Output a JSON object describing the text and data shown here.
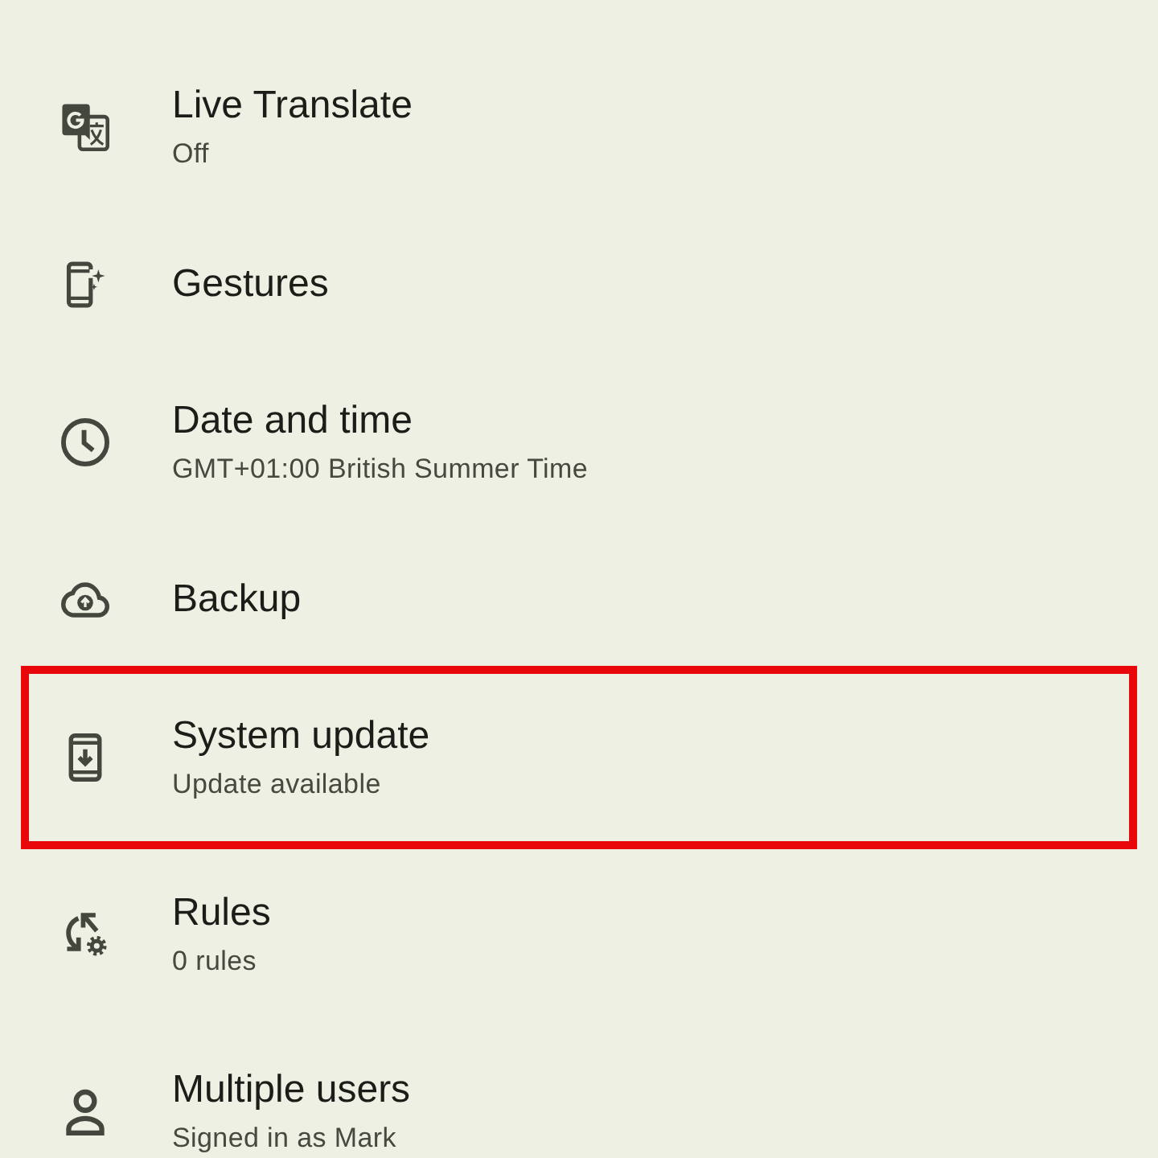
{
  "items": [
    {
      "title": "Live Translate",
      "subtitle": "Off",
      "highlighted": false
    },
    {
      "title": "Gestures",
      "highlighted": false
    },
    {
      "title": "Date and time",
      "subtitle": "GMT+01:00 British Summer Time",
      "highlighted": false
    },
    {
      "title": "Backup",
      "highlighted": false
    },
    {
      "title": "System update",
      "subtitle": "Update available",
      "highlighted": true
    },
    {
      "title": "Rules",
      "subtitle": "0 rules",
      "highlighted": false
    },
    {
      "title": "Multiple users",
      "subtitle": "Signed in as Mark",
      "highlighted": false
    }
  ]
}
